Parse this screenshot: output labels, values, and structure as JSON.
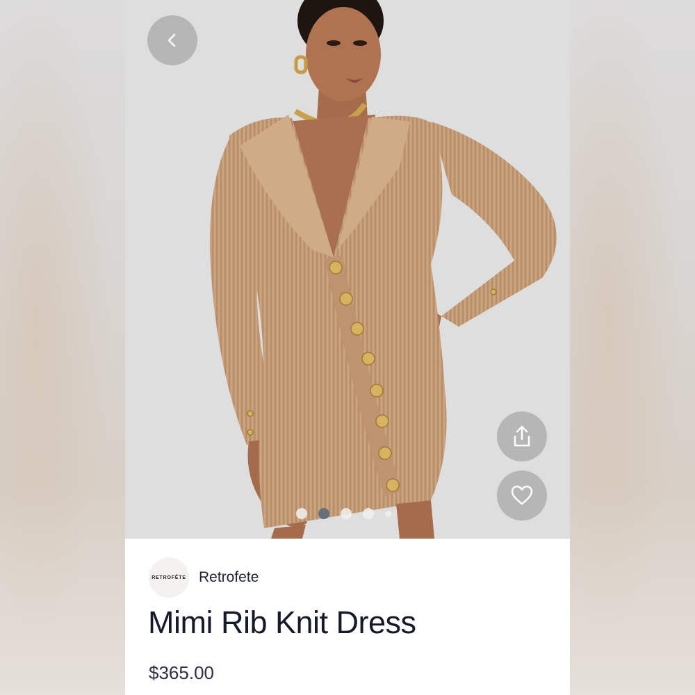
{
  "product": {
    "brand_logo_text": "RETROFÊTE",
    "brand_name": "Retrofete",
    "title": "Mimi Rib Knit Dress",
    "price": "$365.00"
  },
  "gallery": {
    "image_count": 5,
    "active_index": 1
  },
  "icons": {
    "back": "chevron-left-icon",
    "share": "share-icon",
    "favorite": "heart-icon"
  },
  "colors": {
    "hero_background": "#dededf",
    "dress": "#c9a07a",
    "skin": "#a86f4e",
    "title_text": "#141a28",
    "button_overlay": "#969696"
  }
}
